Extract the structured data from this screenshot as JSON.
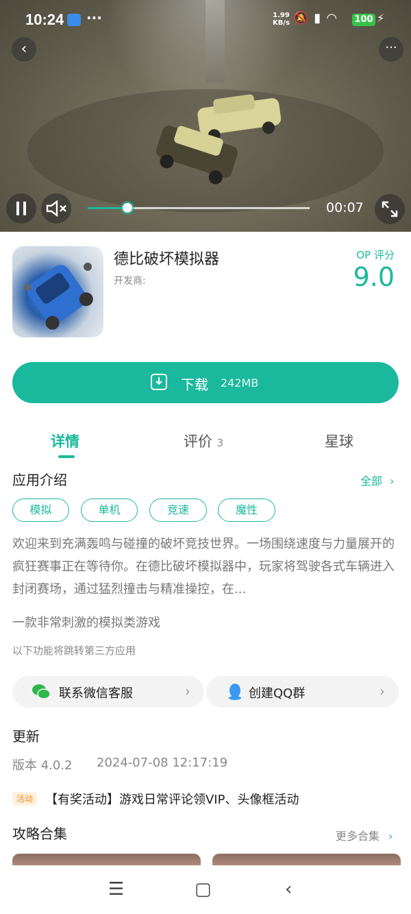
{
  "status": {
    "time": "10:24",
    "overflow": "···",
    "net_speed_value": "1.99",
    "net_speed_unit": "KB/s",
    "battery": "100"
  },
  "video": {
    "elapsed": "00:07",
    "progress_fraction": 0.18
  },
  "app": {
    "name": "德比破坏模拟器",
    "developer_label": "开发商:",
    "score_label": "OP 评分",
    "score": "9.0"
  },
  "download": {
    "label": "下载",
    "size": "242MB"
  },
  "tabs": [
    {
      "label": "详情",
      "active": true
    },
    {
      "label": "评价",
      "count": "3"
    },
    {
      "label": "星球"
    }
  ],
  "intro": {
    "title": "应用介绍",
    "all_link": "全部",
    "tags": [
      "模拟",
      "单机",
      "竞速",
      "魔性"
    ],
    "description": "欢迎来到充满轰鸣与碰撞的破坏竞技世界。一场围绕速度与力量展开的疯狂赛事正在等待你。在德比破坏模拟器中，玩家将驾驶各式车辆进入封闭赛场，通过猛烈撞击与精准操控，在...",
    "tagline": "一款非常刺激的模拟类游戏",
    "third_party_note": "以下功能将跳转第三方应用"
  },
  "contacts": [
    {
      "label": "联系微信客服",
      "icon": "wechat-icon"
    },
    {
      "label": "创建QQ群",
      "icon": "qq-icon"
    }
  ],
  "update": {
    "title": "更新",
    "version": "版本 4.0.2",
    "date": "2024-07-08 12:17:19"
  },
  "activity": {
    "badge": "活动",
    "text": "【有奖活动】游戏日常评论领VIP、头像框活动"
  },
  "guides": {
    "title": "攻略合集",
    "more": "更多合集"
  },
  "colors": {
    "accent": "#1ab89c",
    "activity": "#f08a1f"
  }
}
